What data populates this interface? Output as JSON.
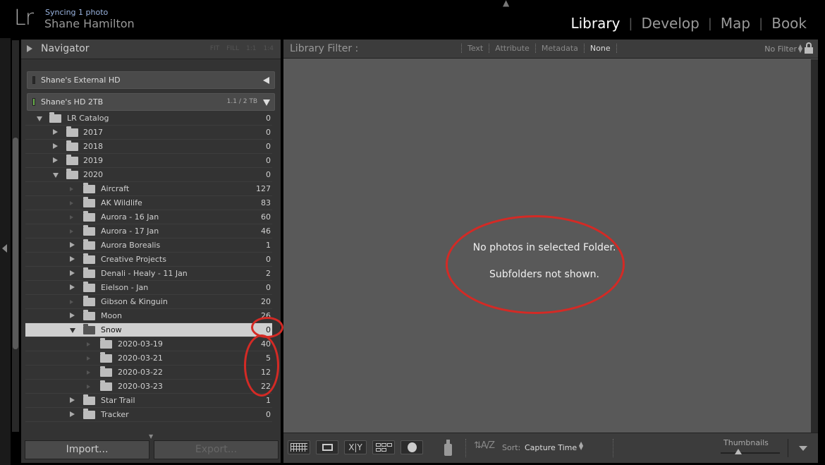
{
  "app": {
    "logo": "Lr",
    "sync_status": "Syncing 1 photo",
    "user_name": "Shane Hamilton"
  },
  "modules": [
    "Library",
    "Develop",
    "Map",
    "Book"
  ],
  "active_module": "Library",
  "navigator": {
    "title": "Navigator",
    "zoom_levels": [
      "FIT",
      "FILL",
      "1:1",
      "1:4"
    ]
  },
  "volumes": [
    {
      "name": "Shane's External HD",
      "size": "",
      "state": "collapsed"
    },
    {
      "name": "Shane's HD 2TB",
      "size": "1.1 / 2 TB",
      "state": "expanded"
    }
  ],
  "folders": [
    {
      "name": "LR Catalog",
      "count": "0",
      "depth": 0,
      "arrow": "down"
    },
    {
      "name": "2017",
      "count": "0",
      "depth": 1,
      "arrow": "right"
    },
    {
      "name": "2018",
      "count": "0",
      "depth": 1,
      "arrow": "right"
    },
    {
      "name": "2019",
      "count": "0",
      "depth": 1,
      "arrow": "right"
    },
    {
      "name": "2020",
      "count": "0",
      "depth": 1,
      "arrow": "down"
    },
    {
      "name": "Aircraft",
      "count": "127",
      "depth": 2,
      "arrow": "faint"
    },
    {
      "name": "AK Wildlife",
      "count": "83",
      "depth": 2,
      "arrow": "faint"
    },
    {
      "name": "Aurora - 16 Jan",
      "count": "60",
      "depth": 2,
      "arrow": "faint"
    },
    {
      "name": "Aurora - 17 Jan",
      "count": "46",
      "depth": 2,
      "arrow": "faint"
    },
    {
      "name": "Aurora Borealis",
      "count": "1",
      "depth": 2,
      "arrow": "right"
    },
    {
      "name": "Creative Projects",
      "count": "0",
      "depth": 2,
      "arrow": "right"
    },
    {
      "name": "Denali - Healy - 11 Jan",
      "count": "2",
      "depth": 2,
      "arrow": "right"
    },
    {
      "name": "Eielson - Jan",
      "count": "0",
      "depth": 2,
      "arrow": "right"
    },
    {
      "name": "Gibson & Kinguin",
      "count": "20",
      "depth": 2,
      "arrow": "faint"
    },
    {
      "name": "Moon",
      "count": "26",
      "depth": 2,
      "arrow": "right"
    },
    {
      "name": "Snow",
      "count": "0",
      "depth": 2,
      "arrow": "down",
      "selected": true
    },
    {
      "name": "2020-03-19",
      "count": "40",
      "depth": 3,
      "arrow": "faint"
    },
    {
      "name": "2020-03-21",
      "count": "5",
      "depth": 3,
      "arrow": "faint"
    },
    {
      "name": "2020-03-22",
      "count": "12",
      "depth": 3,
      "arrow": "faint"
    },
    {
      "name": "2020-03-23",
      "count": "22",
      "depth": 3,
      "arrow": "faint"
    },
    {
      "name": "Star Trail",
      "count": "1",
      "depth": 2,
      "arrow": "right"
    },
    {
      "name": "Tracker",
      "count": "0",
      "depth": 2,
      "arrow": "right"
    }
  ],
  "buttons": {
    "import": "Import...",
    "export": "Export..."
  },
  "library_filter": {
    "title": "Library Filter :",
    "options": [
      "Text",
      "Attribute",
      "Metadata",
      "None"
    ],
    "active": "None",
    "preset": "No Filter"
  },
  "messages": {
    "primary": "No photos in selected Folder.",
    "secondary": "Subfolders not shown."
  },
  "toolbar": {
    "compare_label": "X|Y",
    "sort_label": "Sort:",
    "sort_value": "Capture Time",
    "thumbnails_label": "Thumbnails",
    "thumbnail_size": 0.3
  },
  "colors": {
    "annotation_red": "#d42a25",
    "active_module": "#ffffff",
    "sync_text": "#9ab4e0"
  },
  "icons": {
    "left_edge_toggle": "triangle-left-icon",
    "lock": "lock-icon",
    "spray": "spray-can-icon",
    "sort_direction": "sort-az-icon",
    "face": "people-icon"
  }
}
